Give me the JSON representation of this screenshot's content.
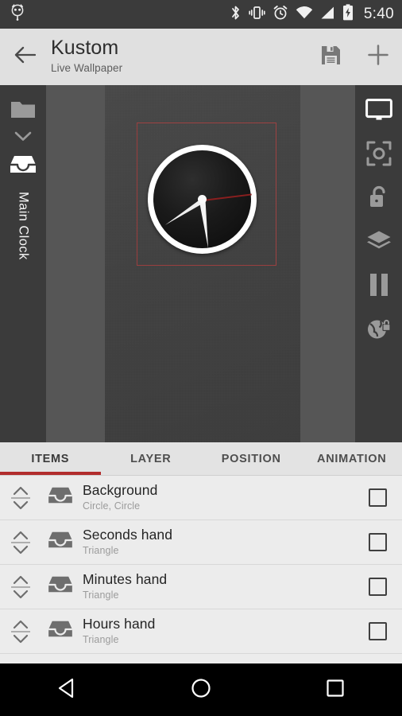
{
  "statusbar": {
    "notification_icon": "owl-icon",
    "icons": [
      "bluetooth-icon",
      "vibrate-icon",
      "alarm-icon",
      "wifi-icon",
      "signal-icon",
      "battery-charging-icon"
    ],
    "time": "5:40"
  },
  "appbar": {
    "back_icon": "back-arrow-icon",
    "title": "Kustom",
    "subtitle": "Live Wallpaper",
    "save_icon": "save-floppy-icon",
    "add_icon": "plus-icon"
  },
  "stage": {
    "left_rail": {
      "folder_icon": "folder-icon",
      "chevron_icon": "chevron-down-icon",
      "tray_icon": "inbox-tray-icon",
      "label": "Main Clock"
    },
    "right_rail": {
      "items": [
        {
          "icon": "monitor-screen-icon",
          "active": true
        },
        {
          "icon": "center-focus-icon",
          "active": false
        },
        {
          "icon": "unlock-padlock-icon",
          "active": false
        },
        {
          "icon": "layers-icon",
          "active": false
        },
        {
          "icon": "pause-icon",
          "active": false
        },
        {
          "icon": "globe-lock-icon",
          "active": false
        }
      ]
    },
    "preview": {
      "selection_color": "#9c4040",
      "clock": {
        "ring_color": "#ffffff",
        "face_color": "#111111",
        "second_hand_color": "#8a1f1f",
        "minute_hand_color": "#f4f4f4",
        "hour_hand_color": "#eeeeee"
      }
    }
  },
  "tabs": [
    {
      "label": "ITEMS",
      "active": true
    },
    {
      "label": "LAYER",
      "active": false
    },
    {
      "label": "POSITION",
      "active": false
    },
    {
      "label": "ANIMATION",
      "active": false
    }
  ],
  "accent_color": "#b22d2d",
  "items": [
    {
      "title": "Background",
      "subtitle": "Circle, Circle",
      "icon": "inbox-tray-icon",
      "checked": false
    },
    {
      "title": "Seconds hand",
      "subtitle": "Triangle",
      "icon": "inbox-tray-icon",
      "checked": false
    },
    {
      "title": "Minutes hand",
      "subtitle": "Triangle",
      "icon": "inbox-tray-icon",
      "checked": false
    },
    {
      "title": "Hours hand",
      "subtitle": "Triangle",
      "icon": "inbox-tray-icon",
      "checked": false
    }
  ],
  "navbar": {
    "back_icon": "nav-back-triangle-icon",
    "home_icon": "nav-home-circle-icon",
    "recents_icon": "nav-recents-square-icon"
  }
}
